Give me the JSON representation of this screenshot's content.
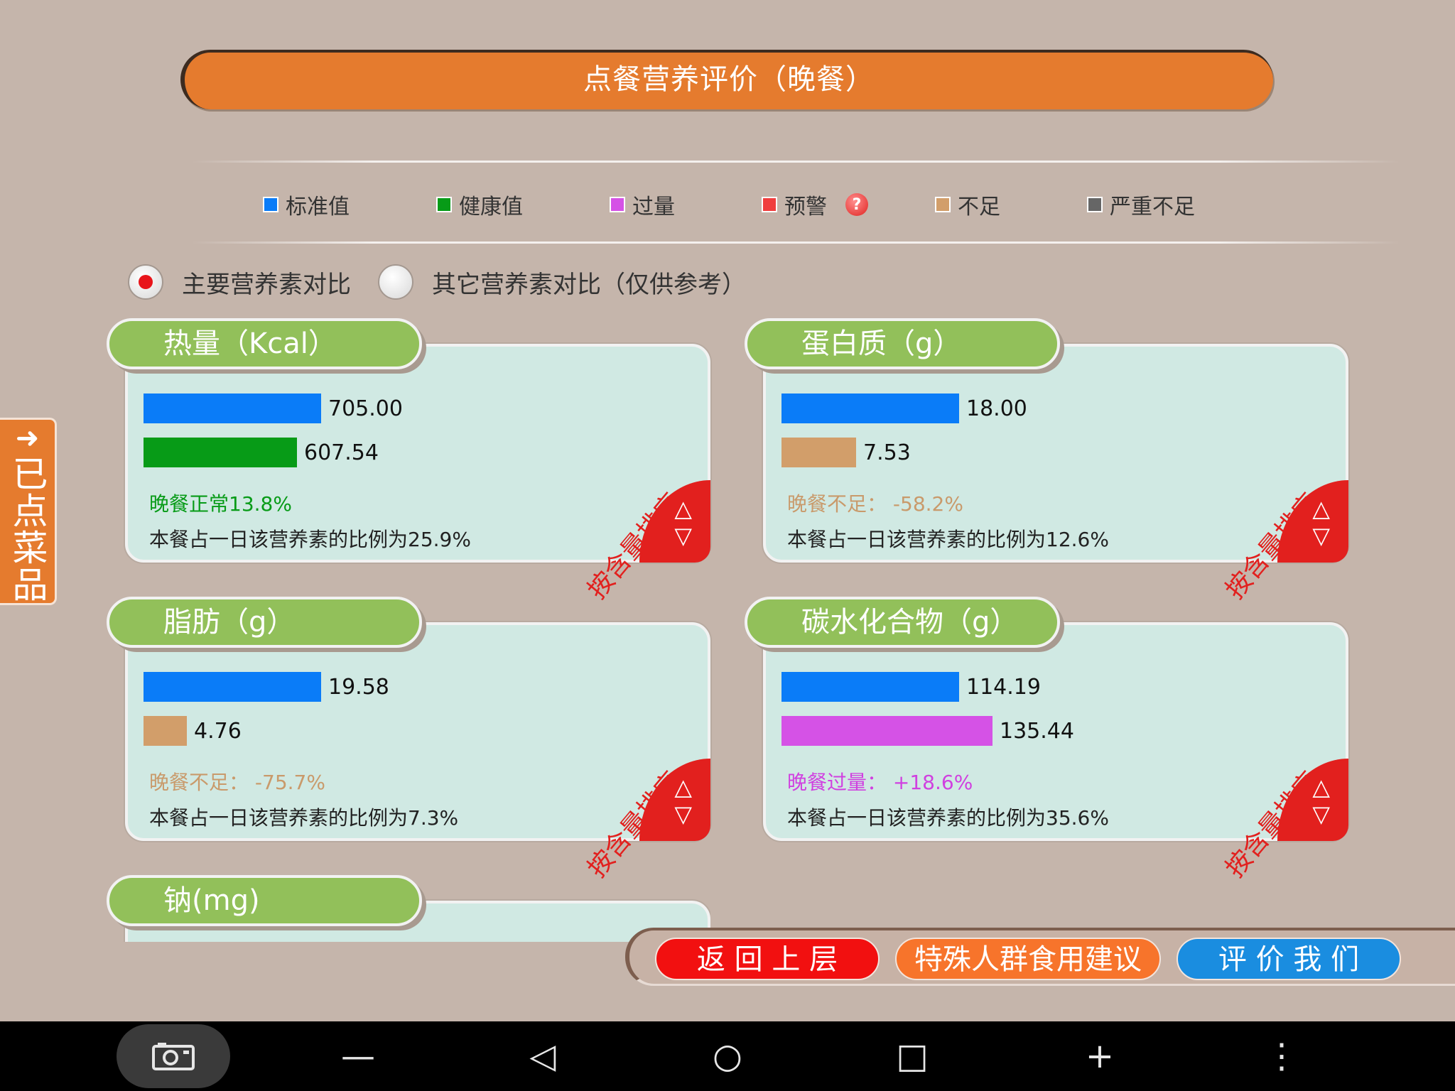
{
  "header": {
    "title": "点餐营养评价（晚餐）"
  },
  "legend": [
    {
      "label": "标准值",
      "color": "#0a7cf8"
    },
    {
      "label": "健康值",
      "color": "#079b17"
    },
    {
      "label": "过量",
      "color": "#d552e6"
    },
    {
      "label": "预警",
      "color": "#f03e3e",
      "icon": "question-help-icon",
      "icon_glyph": "?"
    },
    {
      "label": "不足",
      "color": "#d29e6a"
    },
    {
      "label": "严重不足",
      "color": "#666666"
    }
  ],
  "tabs": {
    "main": {
      "label": "主要营养素对比",
      "selected": true
    },
    "other": {
      "label": "其它营养素对比（仅供参考）",
      "selected": false
    }
  },
  "side_tab": {
    "label": "已点菜品",
    "arrow": "➜"
  },
  "cards": [
    {
      "title": "热量（Kcal）",
      "standard": "705.00",
      "actual": "607.54",
      "actual_fraction": 0.862,
      "actual_color": "#079b17",
      "status": "晚餐正常13.8%",
      "status_color": "#079b17",
      "ratio": "本餐占一日该营养素的比例为25.9%",
      "sort_label": "按含量排序",
      "sort_up": "△",
      "sort_down": "▽"
    },
    {
      "title": "蛋白质（g）",
      "standard": "18.00",
      "actual": "7.53",
      "actual_fraction": 0.418,
      "actual_color": "#d29e6a",
      "status": "晚餐不足： -58.2%",
      "status_color": "#c99a6b",
      "ratio": "本餐占一日该营养素的比例为12.6%",
      "sort_label": "按含量排序",
      "sort_up": "△",
      "sort_down": "▽"
    },
    {
      "title": "脂肪（g）",
      "standard": "19.58",
      "actual": "4.76",
      "actual_fraction": 0.243,
      "actual_color": "#d29e6a",
      "status": "晚餐不足： -75.7%",
      "status_color": "#c99a6b",
      "ratio": "本餐占一日该营养素的比例为7.3%",
      "sort_label": "按含量排序",
      "sort_up": "△",
      "sort_down": "▽"
    },
    {
      "title": "碳水化合物（g）",
      "standard": "114.19",
      "actual": "135.44",
      "actual_fraction": 1.186,
      "actual_color": "#d552e6",
      "status": "晚餐过量： +18.6%",
      "status_color": "#d040e0",
      "ratio": "本餐占一日该营养素的比例为35.6%",
      "sort_label": "按含量排序",
      "sort_up": "△",
      "sort_down": "▽"
    },
    {
      "title": "钠(mg)"
    }
  ],
  "colors": {
    "standard_bar": "#0a7cf8"
  },
  "actions": {
    "back": {
      "label": "返 回 上 层",
      "color": "#f21010"
    },
    "special": {
      "label": "特殊人群食用建议",
      "color": "#f7742b"
    },
    "rate": {
      "label": "评 价 我 们",
      "color": "#1a8de0"
    }
  },
  "system_nav": {
    "screenshot_icon": "camera-icon",
    "volume_down": "—",
    "back": "◁",
    "home": "○",
    "recents": "□",
    "volume_up": "+",
    "menu": "⋮"
  }
}
